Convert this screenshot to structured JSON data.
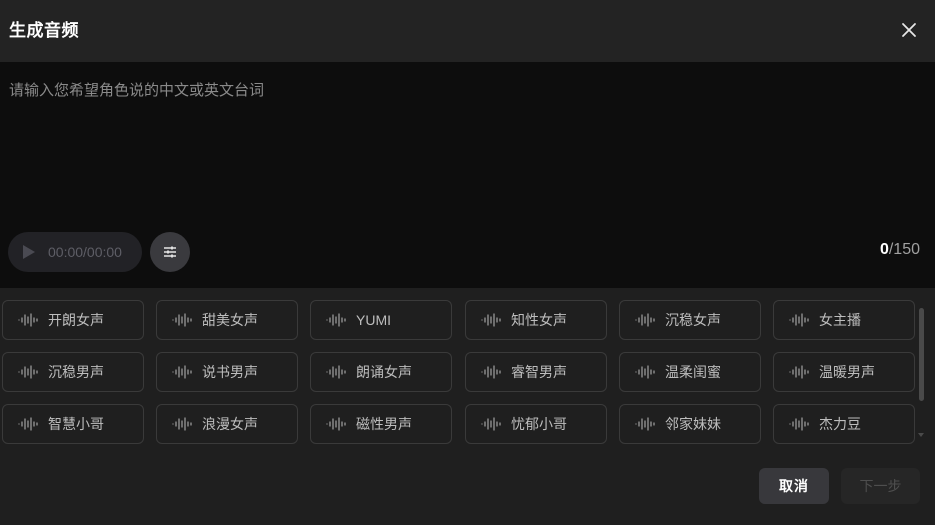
{
  "dialog": {
    "title": "生成音频",
    "close_icon": "close-icon"
  },
  "editor": {
    "placeholder": "请输入您希望角色说的中文或英文台词",
    "value": "",
    "player": {
      "time": "00:00/00:00",
      "play_icon": "play-icon"
    },
    "settings_icon": "sliders-icon",
    "counter": {
      "current": "0",
      "max": "/150"
    }
  },
  "voices": {
    "icon": "waveform-icon",
    "items": [
      "开朗女声",
      "甜美女声",
      "YUMI",
      "知性女声",
      "沉稳女声",
      "女主播",
      "沉稳男声",
      "说书男声",
      "朗诵女声",
      "睿智男声",
      "温柔闺蜜",
      "温暖男声",
      "智慧小哥",
      "浪漫女声",
      "磁性男声",
      "忧郁小哥",
      "邻家妹妹",
      "杰力豆"
    ]
  },
  "footer": {
    "cancel_label": "取消",
    "next_label": "下一步"
  },
  "colors": {
    "background": "#1f1f1f",
    "editor_background": "#0d0d0d",
    "button_border": "#3a3a3a",
    "cancel_background": "#38383c"
  }
}
